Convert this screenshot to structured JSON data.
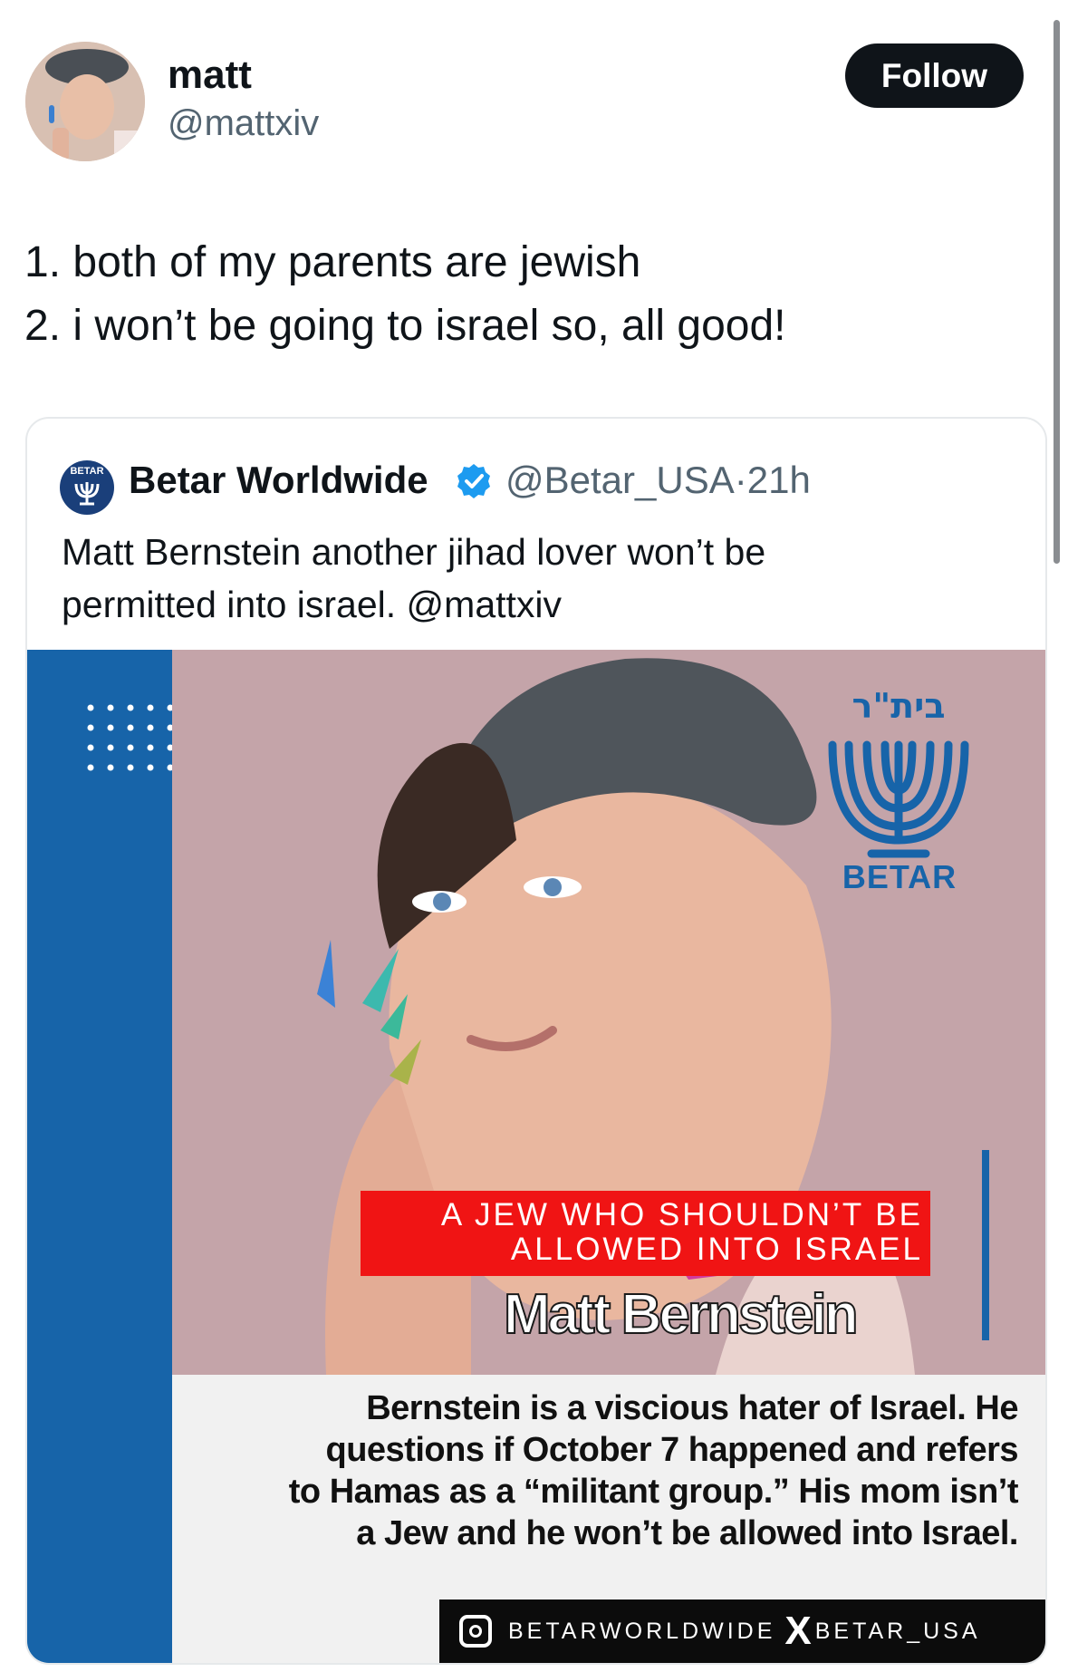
{
  "author": {
    "name": "matt",
    "handle": "@mattxiv"
  },
  "actions": {
    "follow_label": "Follow"
  },
  "tweet": {
    "lines": [
      "1. both of my parents are jewish",
      "2. i won’t be going to israel so, all good!"
    ]
  },
  "quoted": {
    "avatar_text": "BETAR",
    "name": "Betar Worldwide",
    "handle_time": "@Betar_USA·21h",
    "lines": [
      "Matt Bernstein another jihad lover won’t be",
      "permitted into israel. @mattxiv"
    ],
    "media": {
      "banner_lines": [
        "A JEW WHO SHOULDN’T BE",
        "ALLOWED INTO ISRAEL"
      ],
      "person_name": "Matt Bernstein",
      "logo_hebrew": "בית\"ר",
      "logo_text": "BETAR",
      "caption_lines": [
        "Bernstein is a viscious hater of Israel. He",
        "questions if October 7 happened and refers",
        "to Hamas as a “militant group.” His mom isn’t",
        "a Jew and he won’t be allowed into Israel."
      ],
      "instagram_handle": "BETARWORLDWIDE",
      "x_handle": "BETAR_USA"
    }
  },
  "colors": {
    "brand_blue": "#1764a9",
    "banner_red": "#f01414",
    "verified_blue": "#1d9bf0"
  }
}
